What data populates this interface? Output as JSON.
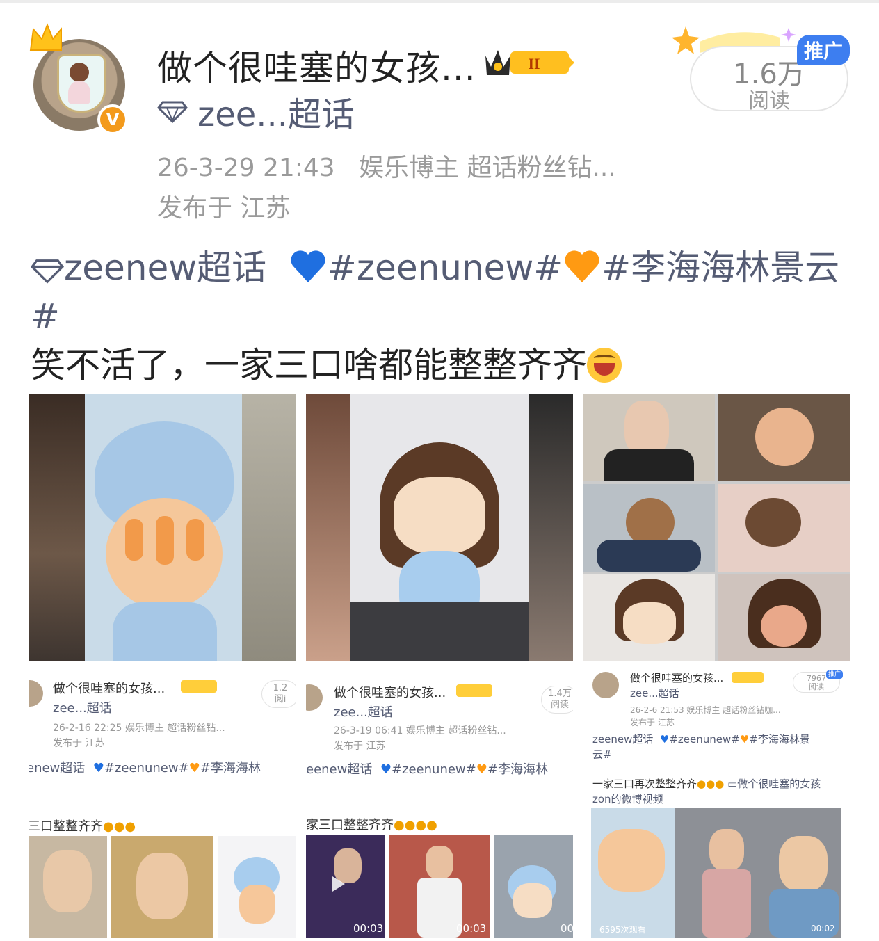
{
  "post": {
    "username": "做个很哇塞的女孩...",
    "supertopic": "zee...超话",
    "time": "26-3-29 21:43",
    "tags": "娱乐博主 超话粉丝钻...",
    "location": "发布于 江苏",
    "reads_value": "1.6万",
    "reads_label": "阅读",
    "promo_label": "推广",
    "vip_level": "II",
    "verified_mark": "V"
  },
  "content": {
    "topic_link": "zeenew超话",
    "hashtag1": "#zeenunew#",
    "hashtag2": "#李海海林景云#",
    "text": "笑不活了，一家三口啥都能整整齐齐"
  },
  "shots": [
    {
      "name": "做个很哇塞的女孩...",
      "topic": "zee...超话",
      "time_tags": "26-2-16 22:25  娱乐博主 超话粉丝钻...",
      "location": "发布于 江苏",
      "reads_value": "1.2",
      "reads_label": "阅i",
      "line1": "enew超话",
      "line1_tags": "#zeenunew#",
      "line1_tail": "#李海海林",
      "line2": "三口整整齐齐"
    },
    {
      "name": "做个很哇塞的女孩...",
      "topic": "zee...超话",
      "time_tags": "26-3-19 06:41  娱乐博主 超话粉丝钻...",
      "location": "发布于 江苏",
      "reads_value": "1.4万",
      "reads_label": "阅读",
      "line1": "eenew超话",
      "line1_tags": "#zeenunew#",
      "line1_tail": "#李海海林",
      "line2": "家三口整整齐齐",
      "dur1": "00:03",
      "dur2": "00:03",
      "dur3": "00"
    },
    {
      "name": "做个很哇塞的女孩...",
      "topic": "zee...超话",
      "time_tags": "26-2-6 21:53  娱乐博主 超话粉丝钻咖...",
      "location": "发布于 江苏",
      "reads_value": "7967",
      "reads_label": "阅读",
      "promo": "推广",
      "line1": "zeenew超话",
      "line1_tags": "#zeenunew#",
      "line1_tail": "#李海海林景",
      "line1b": "云#",
      "line2": "一家三口再次整整齐齐",
      "line2_link": "做个很哇塞的女孩",
      "line3": "zon的微博视频",
      "views": "6595次观看",
      "dur": "00:02"
    }
  ]
}
